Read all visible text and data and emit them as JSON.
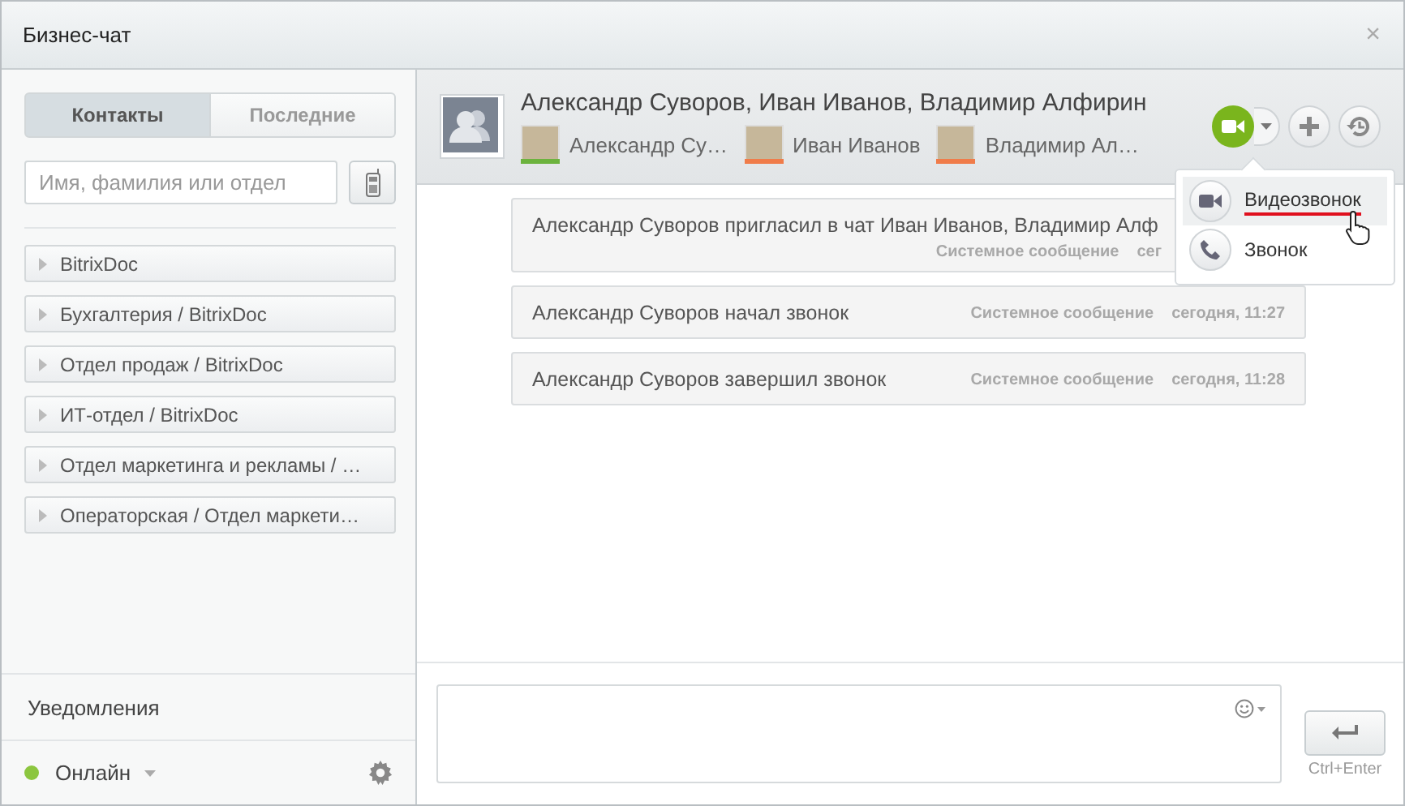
{
  "window": {
    "title": "Бизнес-чат",
    "close": "×"
  },
  "tabs": [
    {
      "label": "Контакты",
      "selected": true
    },
    {
      "label": "Последние",
      "selected": false
    }
  ],
  "search": {
    "placeholder": "Имя, фамилия или отдел"
  },
  "groups": [
    {
      "label": "BitrixDoc",
      "expanded": false
    },
    {
      "label": "Бухгалтерия / BitrixDoc",
      "expanded": false
    },
    {
      "label": "Отдел продаж / BitrixDoc",
      "expanded": false
    },
    {
      "label": "ИТ-отдел / BitrixDoc",
      "expanded": false
    },
    {
      "label": "Отдел маркетинга и рекламы / …",
      "expanded": false
    },
    {
      "label": "Операторская / Отдел маркети…",
      "expanded": false
    }
  ],
  "notifications": "Уведомления",
  "status": {
    "label": "Онлайн",
    "color": "#8cc63f"
  },
  "chat": {
    "title": "Александр Суворов, Иван Иванов, Владимир Алфирин",
    "participants": [
      {
        "name": "Александр Су…",
        "color": "#6cb33e"
      },
      {
        "name": "Иван Иванов",
        "color": "#f07c4a"
      },
      {
        "name": "Владимир Ал…",
        "color": "#f07c4a"
      }
    ]
  },
  "call_menu": [
    {
      "label": "Видеозвонок",
      "kind": "video",
      "selected": true
    },
    {
      "label": "Звонок",
      "kind": "phone",
      "selected": false
    }
  ],
  "messages": [
    {
      "text": "Александр Суворов пригласил в чат Иван Иванов, Владимир Алф",
      "meta": "Системное сообщение",
      "time": "сег"
    },
    {
      "text": "Александр Суворов начал звонок",
      "meta": "Системное сообщение",
      "time": "сегодня, 11:27"
    },
    {
      "text": "Александр Суворов завершил звонок",
      "meta": "Системное сообщение",
      "time": "сегодня, 11:28"
    }
  ],
  "send_hint": "Ctrl+Enter"
}
